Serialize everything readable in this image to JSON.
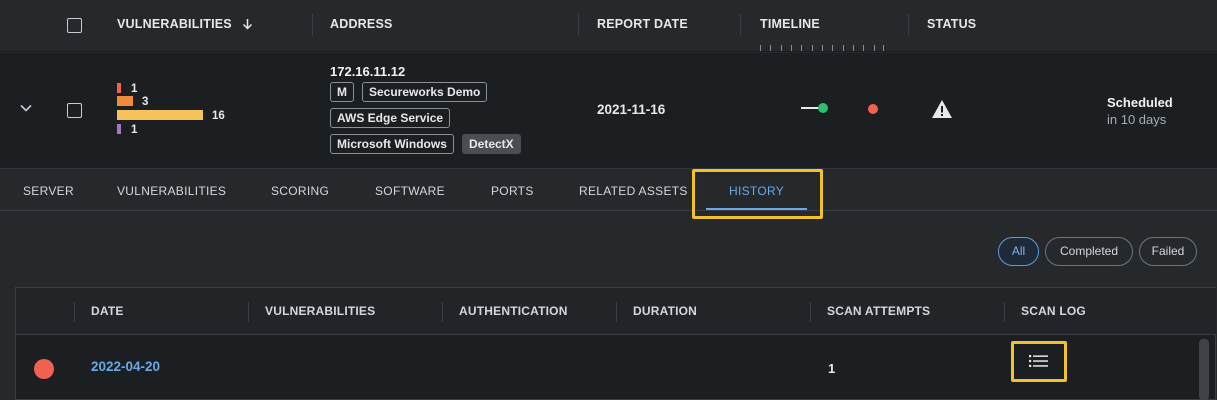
{
  "header": {
    "columns": [
      "VULNERABILITIES",
      "ADDRESS",
      "REPORT DATE",
      "TIMELINE",
      "STATUS"
    ],
    "sort_icon": "arrow-down-icon"
  },
  "asset": {
    "vulnerability_counts": [
      {
        "severity": "critical",
        "count": "1",
        "color": "#f2604f"
      },
      {
        "severity": "high",
        "count": "3",
        "color": "#f08a3c"
      },
      {
        "severity": "medium",
        "count": "16",
        "color": "#f6c25c"
      },
      {
        "severity": "low",
        "count": "1",
        "color": "#a576c4"
      }
    ],
    "address": "172.16.11.12",
    "tags": [
      "M",
      "Secureworks Demo",
      "AWS Edge Service",
      "Microsoft Windows",
      "DetectX"
    ],
    "report_date": "2021-11-16",
    "timeline_colors": {
      "scan": "#2fbf6a",
      "alert": "#f2604f"
    },
    "status": "Scheduled",
    "status_sub": "in 10 days"
  },
  "tabs": [
    "SERVER",
    "VULNERABILITIES",
    "SCORING",
    "SOFTWARE",
    "PORTS",
    "RELATED ASSETS",
    "HISTORY"
  ],
  "active_tab": "HISTORY",
  "filters": [
    "All",
    "Completed",
    "Failed"
  ],
  "active_filter": "All",
  "history": {
    "columns": [
      "DATE",
      "VULNERABILITIES",
      "AUTHENTICATION",
      "DURATION",
      "SCAN ATTEMPTS",
      "SCAN LOG"
    ],
    "rows": [
      {
        "status_color": "#f2604f",
        "date": "2022-04-20",
        "vulnerabilities": "",
        "authentication": "",
        "duration": "",
        "scan_attempts": "1",
        "scan_log_icon": "list-icon"
      }
    ]
  },
  "highlight_color": "#f3c22b"
}
